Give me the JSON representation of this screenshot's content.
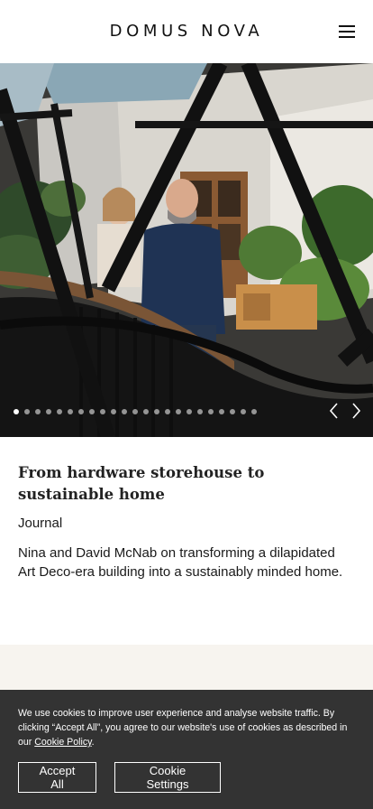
{
  "header": {
    "logo": "DOMUS NOVA",
    "menu_icon": "hamburger-menu-icon"
  },
  "carousel": {
    "slide_count": 23,
    "active_index": 0,
    "prev_icon": "chevron-left-icon",
    "next_icon": "chevron-right-icon"
  },
  "article": {
    "title": "From hardware storehouse to sustainable home",
    "category": "Journal",
    "description": "Nina and David McNab on transforming a dilapidated Art Deco-era building into a sustainably minded home."
  },
  "cookie_banner": {
    "text_before_link": "We use cookies to improve user experience and analyse website traffic. By clicking “Accept All”, you agree to our website's use of cookies as described in our ",
    "link_text": "Cookie Policy",
    "text_after_link": ".",
    "accept_label": "Accept All",
    "settings_label": "Cookie Settings"
  },
  "colors": {
    "banner_bg": "#333333",
    "section_bg": "#f7f4ef"
  }
}
